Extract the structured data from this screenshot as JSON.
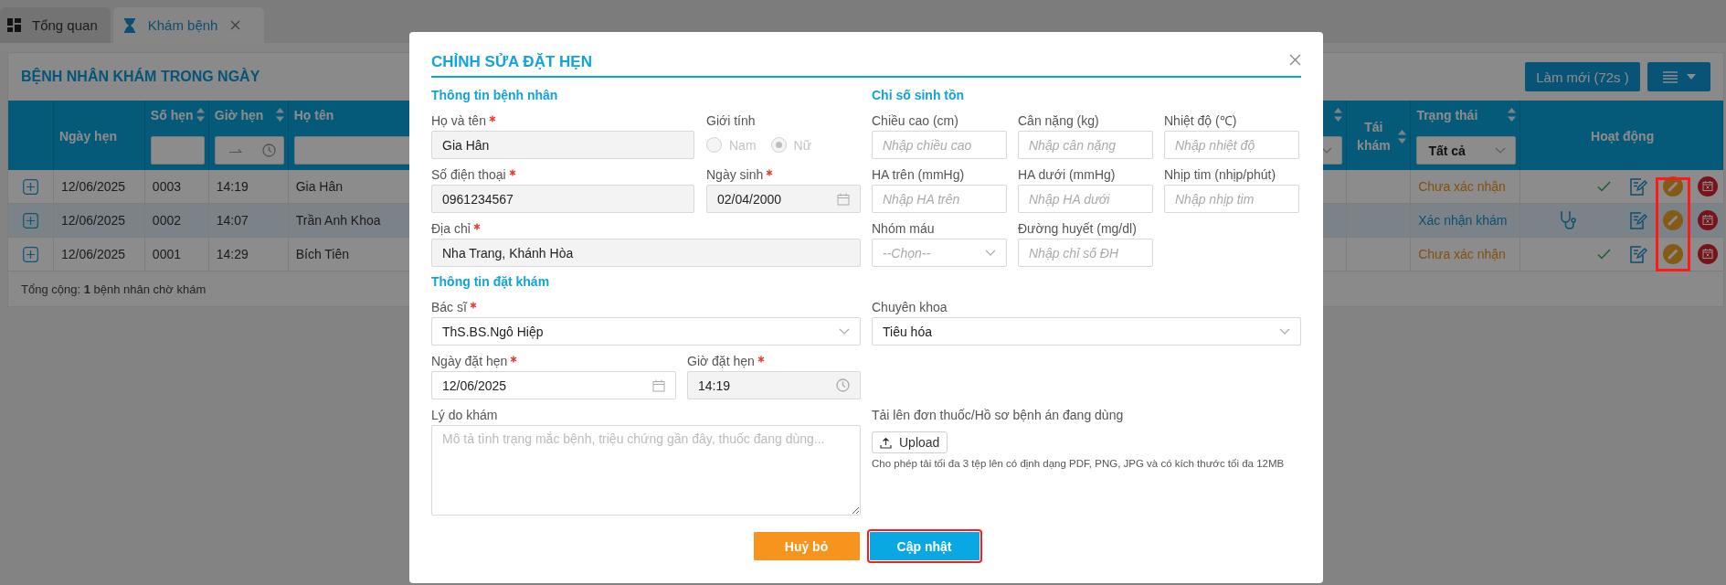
{
  "tabs": [
    {
      "label": "Tổng quan",
      "kind": "dashboard",
      "selected": false,
      "closable": false
    },
    {
      "label": "Khám bệnh",
      "kind": "hourglass",
      "selected": true,
      "closable": true
    }
  ],
  "panel": {
    "title": "BỆNH NHÂN KHÁM TRONG NGÀY",
    "refresh_button": "Làm mới (72s )",
    "footer": "Tổng cộng: **1** bệnh nhân chờ khám"
  },
  "table": {
    "columns": [
      {
        "kind": "expand"
      },
      {
        "label": "Ngày hẹn",
        "sortable": false
      },
      {
        "label": "Số hẹn",
        "sortable": true,
        "filter": {
          "kind": "text"
        }
      },
      {
        "label": "Giờ hẹn",
        "sortable": true,
        "filter": {
          "kind": "timerange"
        }
      },
      {
        "label": "Họ tên",
        "sortable": false,
        "filter": {
          "kind": "text"
        }
      },
      {
        "sortable": true,
        "filter": {
          "kind": "select"
        }
      },
      {
        "label": "Tái khám",
        "sortable": true
      },
      {
        "label": "Trạng thái",
        "sortable": true,
        "filter": {
          "kind": "select",
          "value": "Tất cả"
        }
      },
      {
        "label": "Hoạt động",
        "sortable": false
      }
    ],
    "rows": [
      {
        "date": "12/06/2025",
        "number": "0003",
        "time": "14:19",
        "name": "Gia Hân",
        "status": {
          "label": "Chưa xác nhận",
          "kind": "pending"
        },
        "selected": false,
        "actions": [
          {
            "kind": "confirm",
            "highlighted": false
          },
          {
            "kind": "note",
            "highlighted": false
          },
          {
            "kind": "edit",
            "highlighted": true
          },
          {
            "kind": "cancel",
            "highlighted": false
          }
        ]
      },
      {
        "date": "12/06/2025",
        "number": "0002",
        "time": "14:07",
        "name": "Trần Anh Khoa",
        "status": {
          "label": "Xác nhận khám",
          "kind": "confirmed"
        },
        "selected": true,
        "actions": [
          {
            "kind": "examine",
            "highlighted": false
          },
          {
            "kind": "note",
            "highlighted": false
          },
          {
            "kind": "edit",
            "highlighted": true
          },
          {
            "kind": "cancel",
            "highlighted": false
          }
        ]
      },
      {
        "date": "12/06/2025",
        "number": "0001",
        "time": "14:29",
        "name": "Bích Tiên",
        "status": {
          "label": "Chưa xác nhận",
          "kind": "pending"
        },
        "selected": false,
        "actions": [
          {
            "kind": "confirm",
            "highlighted": false
          },
          {
            "kind": "note",
            "highlighted": false
          },
          {
            "kind": "edit",
            "highlighted": true
          },
          {
            "kind": "cancel",
            "highlighted": false
          }
        ]
      }
    ]
  },
  "modal": {
    "title": "CHỈNH SỬA ĐẶT HẸN",
    "patient": {
      "heading": "Thông tin bệnh nhân",
      "fields": [
        {
          "label": "Họ và tên",
          "kind": "text",
          "value": "Gia Hân",
          "required": true,
          "readonly": true
        },
        {
          "label": "Giới tính",
          "kind": "radio",
          "required": false,
          "disabled": true,
          "options": [
            {
              "label": "Nam",
              "selected": false
            },
            {
              "label": "Nữ",
              "selected": true
            }
          ]
        },
        {
          "label": "Số điện thoại",
          "kind": "text",
          "value": "0961234567",
          "required": true,
          "readonly": true
        },
        {
          "label": "Ngày sinh",
          "kind": "date",
          "value": "02/04/2000",
          "required": true,
          "readonly": true
        },
        {
          "label": "Địa chỉ",
          "kind": "text",
          "value": "Nha Trang, Khánh Hòa",
          "required": true,
          "readonly": true
        }
      ]
    },
    "vitals": {
      "heading": "Chỉ số sinh tồn",
      "fields": [
        {
          "label": "Chiều cao (cm)",
          "kind": "text",
          "placeholder": "Nhập chiều cao",
          "required": false,
          "readonly": false
        },
        {
          "label": "Cân nặng (kg)",
          "kind": "text",
          "placeholder": "Nhập cân nặng",
          "required": false,
          "readonly": false
        },
        {
          "label": "Nhiệt độ (℃)",
          "kind": "text",
          "placeholder": "Nhập nhiệt độ",
          "required": false,
          "readonly": false
        },
        {
          "label": "HA trên (mmHg)",
          "kind": "text",
          "placeholder": "Nhập HA trên",
          "required": false,
          "readonly": false
        },
        {
          "label": "HA dưới (mmHg)",
          "kind": "text",
          "placeholder": "Nhập HA dưới",
          "required": false,
          "readonly": false
        },
        {
          "label": "Nhịp tim (nhịp/phút)",
          "kind": "text",
          "placeholder": "Nhập nhịp tim",
          "required": false,
          "readonly": false
        },
        {
          "label": "Nhóm máu",
          "kind": "select",
          "placeholder": "--Chọn--",
          "required": false,
          "readonly": false
        },
        {
          "label": "Đường huyết (mg/dl)",
          "kind": "text",
          "placeholder": "Nhập chỉ số ĐH",
          "required": false,
          "readonly": false
        }
      ]
    },
    "booking": {
      "heading": "Thông tin đặt khám",
      "fields": [
        {
          "label": "Bác sĩ",
          "kind": "select",
          "value": "ThS.BS.Ngô Hiệp",
          "required": true,
          "readonly": false
        },
        {
          "label": "Chuyên khoa",
          "kind": "select",
          "value": "Tiêu hóa",
          "required": false,
          "readonly": false
        },
        {
          "label": "Ngày đặt hẹn",
          "kind": "date",
          "value": "12/06/2025",
          "required": true,
          "readonly": false
        },
        {
          "label": "Giờ đặt hẹn",
          "kind": "time",
          "value": "14:19",
          "required": true,
          "readonly": true
        },
        {
          "label": "Lý do khám",
          "kind": "textarea",
          "placeholder": "Mô tả tình trạng mắc bệnh, triệu chứng gần đây, thuốc đang dùng...",
          "required": false
        },
        {
          "label": "Tải lên đơn thuốc/Hồ sơ bệnh án đang dùng",
          "kind": "upload",
          "button": "Upload",
          "hint": "Cho phép tải tối đa 3 tệp lên có định dạng PDF, PNG, JPG và có kích thước tối đa 12MB",
          "required": false
        }
      ]
    },
    "buttons": [
      {
        "label": "Huỷ bỏ",
        "kind": "cancel",
        "highlighted": false
      },
      {
        "label": "Cập nhật",
        "kind": "primary",
        "highlighted": true
      }
    ]
  }
}
